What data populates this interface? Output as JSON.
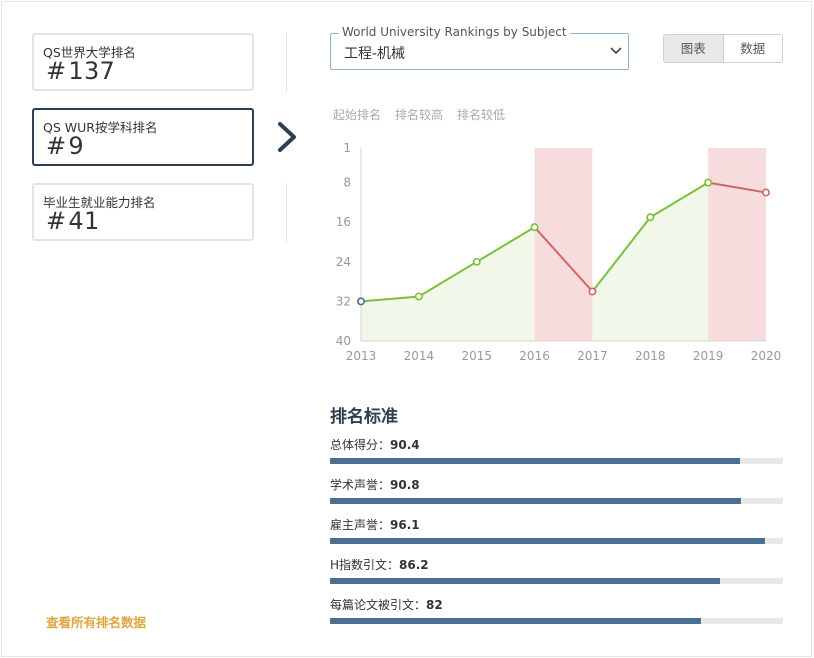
{
  "left_cards": [
    {
      "label": "QS世界大学排名",
      "hash": "#",
      "value": "137",
      "active": false
    },
    {
      "label": "QS WUR按学科排名",
      "hash": "#",
      "value": "9",
      "active": true
    },
    {
      "label": "毕业生就业能力排名",
      "hash": "#",
      "value": "41",
      "active": false
    }
  ],
  "all_link": "查看所有排名数据",
  "select": {
    "legend": "World University Rankings by Subject",
    "value": "工程-机械"
  },
  "toggle": {
    "chart": "图表",
    "data": "数据",
    "active": "chart"
  },
  "chart_legend": [
    "起始排名",
    "排名较高",
    "排名较低"
  ],
  "chart_data": {
    "type": "line",
    "x": [
      "2013",
      "2014",
      "2015",
      "2016",
      "2017",
      "2018",
      "2019",
      "2020"
    ],
    "series": [
      {
        "values": [
          32,
          31,
          24,
          17,
          30,
          15,
          8,
          10
        ]
      }
    ],
    "y_ticks": [
      "1",
      "8",
      "16",
      "24",
      "32",
      "40"
    ],
    "ylim": [
      40,
      1
    ],
    "y_inverted": true,
    "colors": {
      "higher": "#7cbf3a",
      "lower": "#cf6767",
      "start": "#4a6f95",
      "higher_fill": "#f1f8ea",
      "lower_fill": "#f6dcdc"
    }
  },
  "criteria": {
    "title": "排名标准",
    "items": [
      {
        "label": "总体得分：",
        "score": "90.4",
        "value": 90.4
      },
      {
        "label": "学术声誉：",
        "score": "90.8",
        "value": 90.8
      },
      {
        "label": "雇主声誉：",
        "score": "96.1",
        "value": 96.1
      },
      {
        "label": "H指数引文：",
        "score": "86.2",
        "value": 86.2
      },
      {
        "label": "每篇论文被引文：",
        "score": "82",
        "value": 82
      }
    ]
  }
}
